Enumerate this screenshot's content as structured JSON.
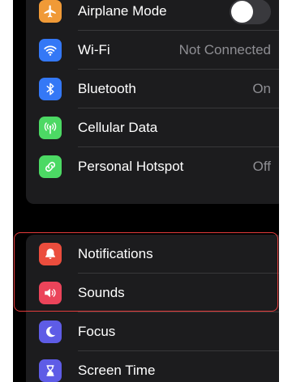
{
  "connectivity": {
    "airplane_mode": {
      "label": "Airplane Mode",
      "icon": "airplane-icon",
      "color": "#f09a37",
      "toggle_on": false
    },
    "wifi": {
      "label": "Wi-Fi",
      "value": "Not Connected",
      "icon": "wifi-icon",
      "color": "#3478f6"
    },
    "bluetooth": {
      "label": "Bluetooth",
      "value": "On",
      "icon": "bluetooth-icon",
      "color": "#3478f6"
    },
    "cellular": {
      "label": "Cellular Data",
      "icon": "cellular-antenna-icon",
      "color": "#4cd964"
    },
    "hotspot": {
      "label": "Personal Hotspot",
      "value": "Off",
      "icon": "link-icon",
      "color": "#4cd964"
    }
  },
  "alerts": {
    "notifications": {
      "label": "Notifications",
      "icon": "bell-icon",
      "color": "#eb4d3d"
    },
    "sounds": {
      "label": "Sounds",
      "icon": "speaker-icon",
      "color": "#eb445a"
    },
    "focus": {
      "label": "Focus",
      "icon": "moon-icon",
      "color": "#5e5ce6"
    },
    "screen_time": {
      "label": "Screen Time",
      "icon": "hourglass-icon",
      "color": "#5e5ce6"
    }
  },
  "highlight_color": "#e33b3b"
}
